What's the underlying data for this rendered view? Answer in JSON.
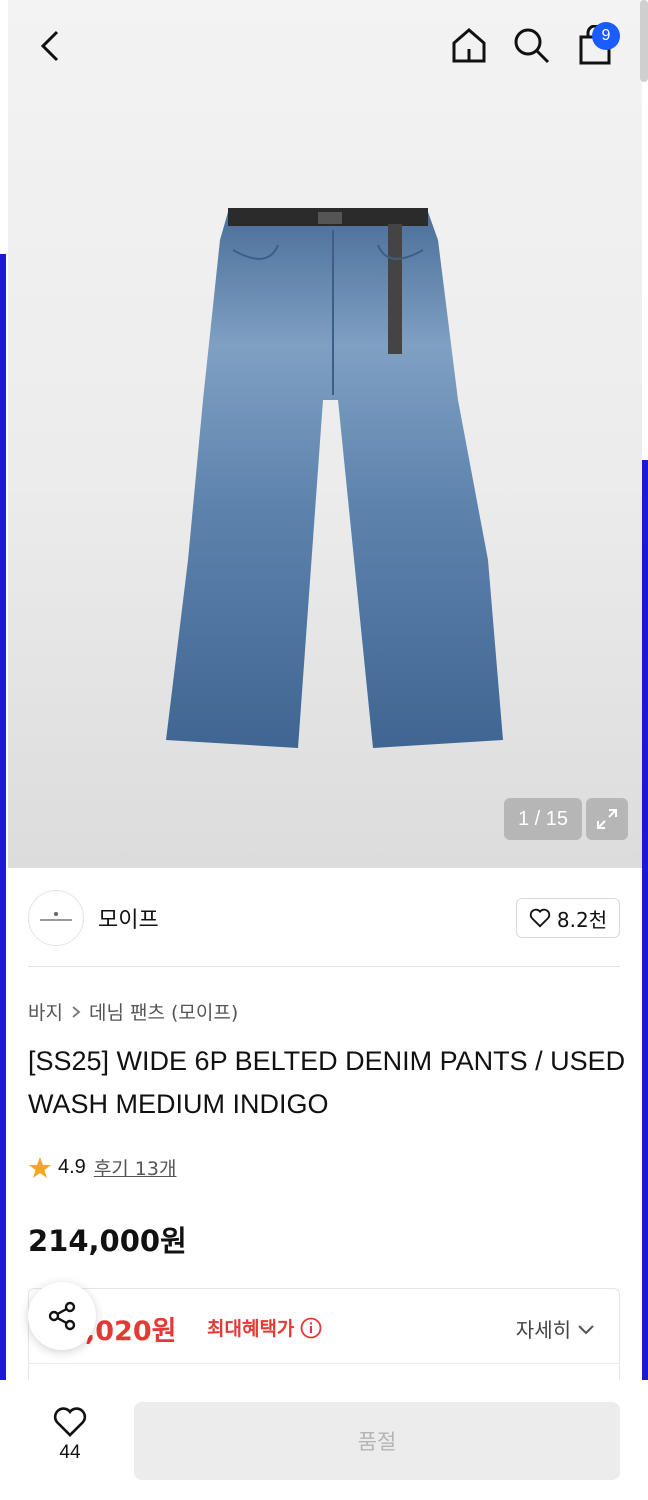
{
  "header": {
    "cart_count": "9"
  },
  "gallery": {
    "counter": "1 / 15"
  },
  "brand": {
    "name": "모이프",
    "likes": "8.2천"
  },
  "breadcrumb": {
    "category": "바지",
    "subcategory": "데님 팬츠 (모이프)"
  },
  "product": {
    "title": "[SS25] WIDE 6P BELTED DENIM PANTS / USED WASH MEDIUM INDIGO",
    "rating": "4.9",
    "reviews": "후기 13개",
    "price": "214,000원"
  },
  "benefit": {
    "sale_price": ",020원",
    "label": "최대혜택가",
    "detail": "자세히"
  },
  "bottom": {
    "wish_count": "44",
    "buy_label": "품절"
  },
  "colors": {
    "accent_blue": "#1a5cff",
    "sale_red": "#e53935",
    "star": "#f5a623"
  }
}
